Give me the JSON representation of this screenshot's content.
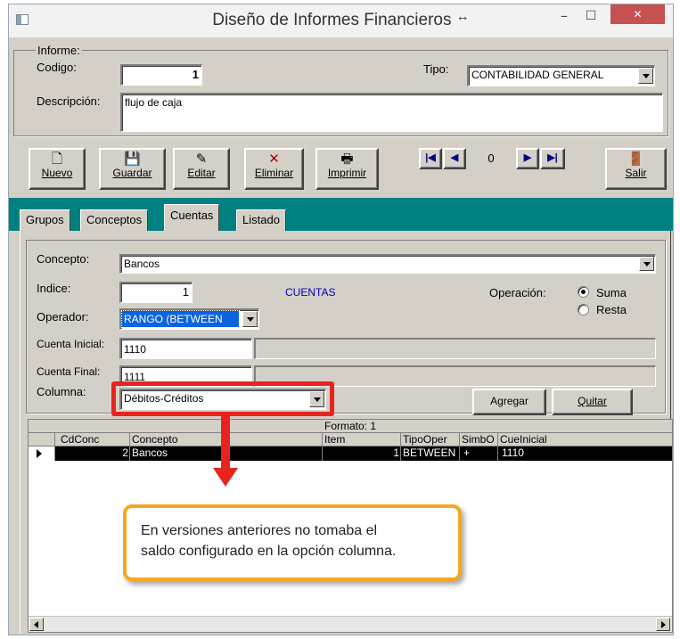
{
  "window": {
    "title": "Diseño de Informes  Financieros",
    "resize_glyph": "↔",
    "app_icon": "app-icon",
    "minimize_glyph": "–",
    "maximize_glyph": "☐",
    "close_glyph": "✕",
    "close_color": "#c75050"
  },
  "informe": {
    "legend": "Informe:",
    "codigo_label": "Codigo:",
    "codigo_value": "1",
    "tipo_label": "Tipo:",
    "tipo_value": "CONTABILIDAD GENERAL",
    "descripcion_label": "Descripción:",
    "descripcion_value": "flujo de caja"
  },
  "toolbar": {
    "nuevo": "Nuevo",
    "guardar": "Guardar",
    "editar": "Editar",
    "eliminar": "Eliminar",
    "imprimir": "Imprimir",
    "salir": "Salir",
    "nav_first": "|◀",
    "nav_prev": "◀",
    "record": "0",
    "nav_next": "▶",
    "nav_last": "▶|"
  },
  "tabs": [
    "Grupos",
    "Conceptos",
    "Cuentas",
    "Listado"
  ],
  "active_tab": "Cuentas",
  "cuentas": {
    "concepto_label": "Concepto:",
    "concepto_value": "Bancos",
    "indice_label": "Indice:",
    "indice_value": "1",
    "cuentas_caption": "CUENTAS",
    "cuentas_color": "#0000c0",
    "operacion_label": "Operación:",
    "op_suma": "Suma",
    "op_resta": "Resta",
    "op_selected": "Suma",
    "operador_label": "Operador:",
    "operador_value": "RANGO (BETWEEN",
    "operador_highlight": "#0a64e0",
    "cuenta_inicial_label": "Cuenta Inicial:",
    "cuenta_inicial_value": "1110",
    "cuenta_final_label": "Cuenta Final:",
    "cuenta_final_value": "1111",
    "columna_label": "Columna:",
    "columna_value": "Débitos-Créditos",
    "agregar": "Agregar",
    "quitar": "Quitar"
  },
  "grid": {
    "caption": "Formato: 1",
    "columns": [
      "CdConc",
      "Concepto",
      "Item",
      "TipoOper",
      "SimbO",
      "CueInicial"
    ],
    "rows": [
      {
        "cdconc": "2",
        "concepto": "Bancos",
        "item": "1",
        "tipooper": "BETWEEN",
        "simbo": "+",
        "cueinicial": "1110"
      }
    ]
  },
  "annotation": {
    "text_line1": "En versiones anteriores no tomaba el",
    "text_line2": "saldo configurado en la opción columna.",
    "highlight_color": "#e8231e",
    "callout_border": "#f6a623"
  }
}
